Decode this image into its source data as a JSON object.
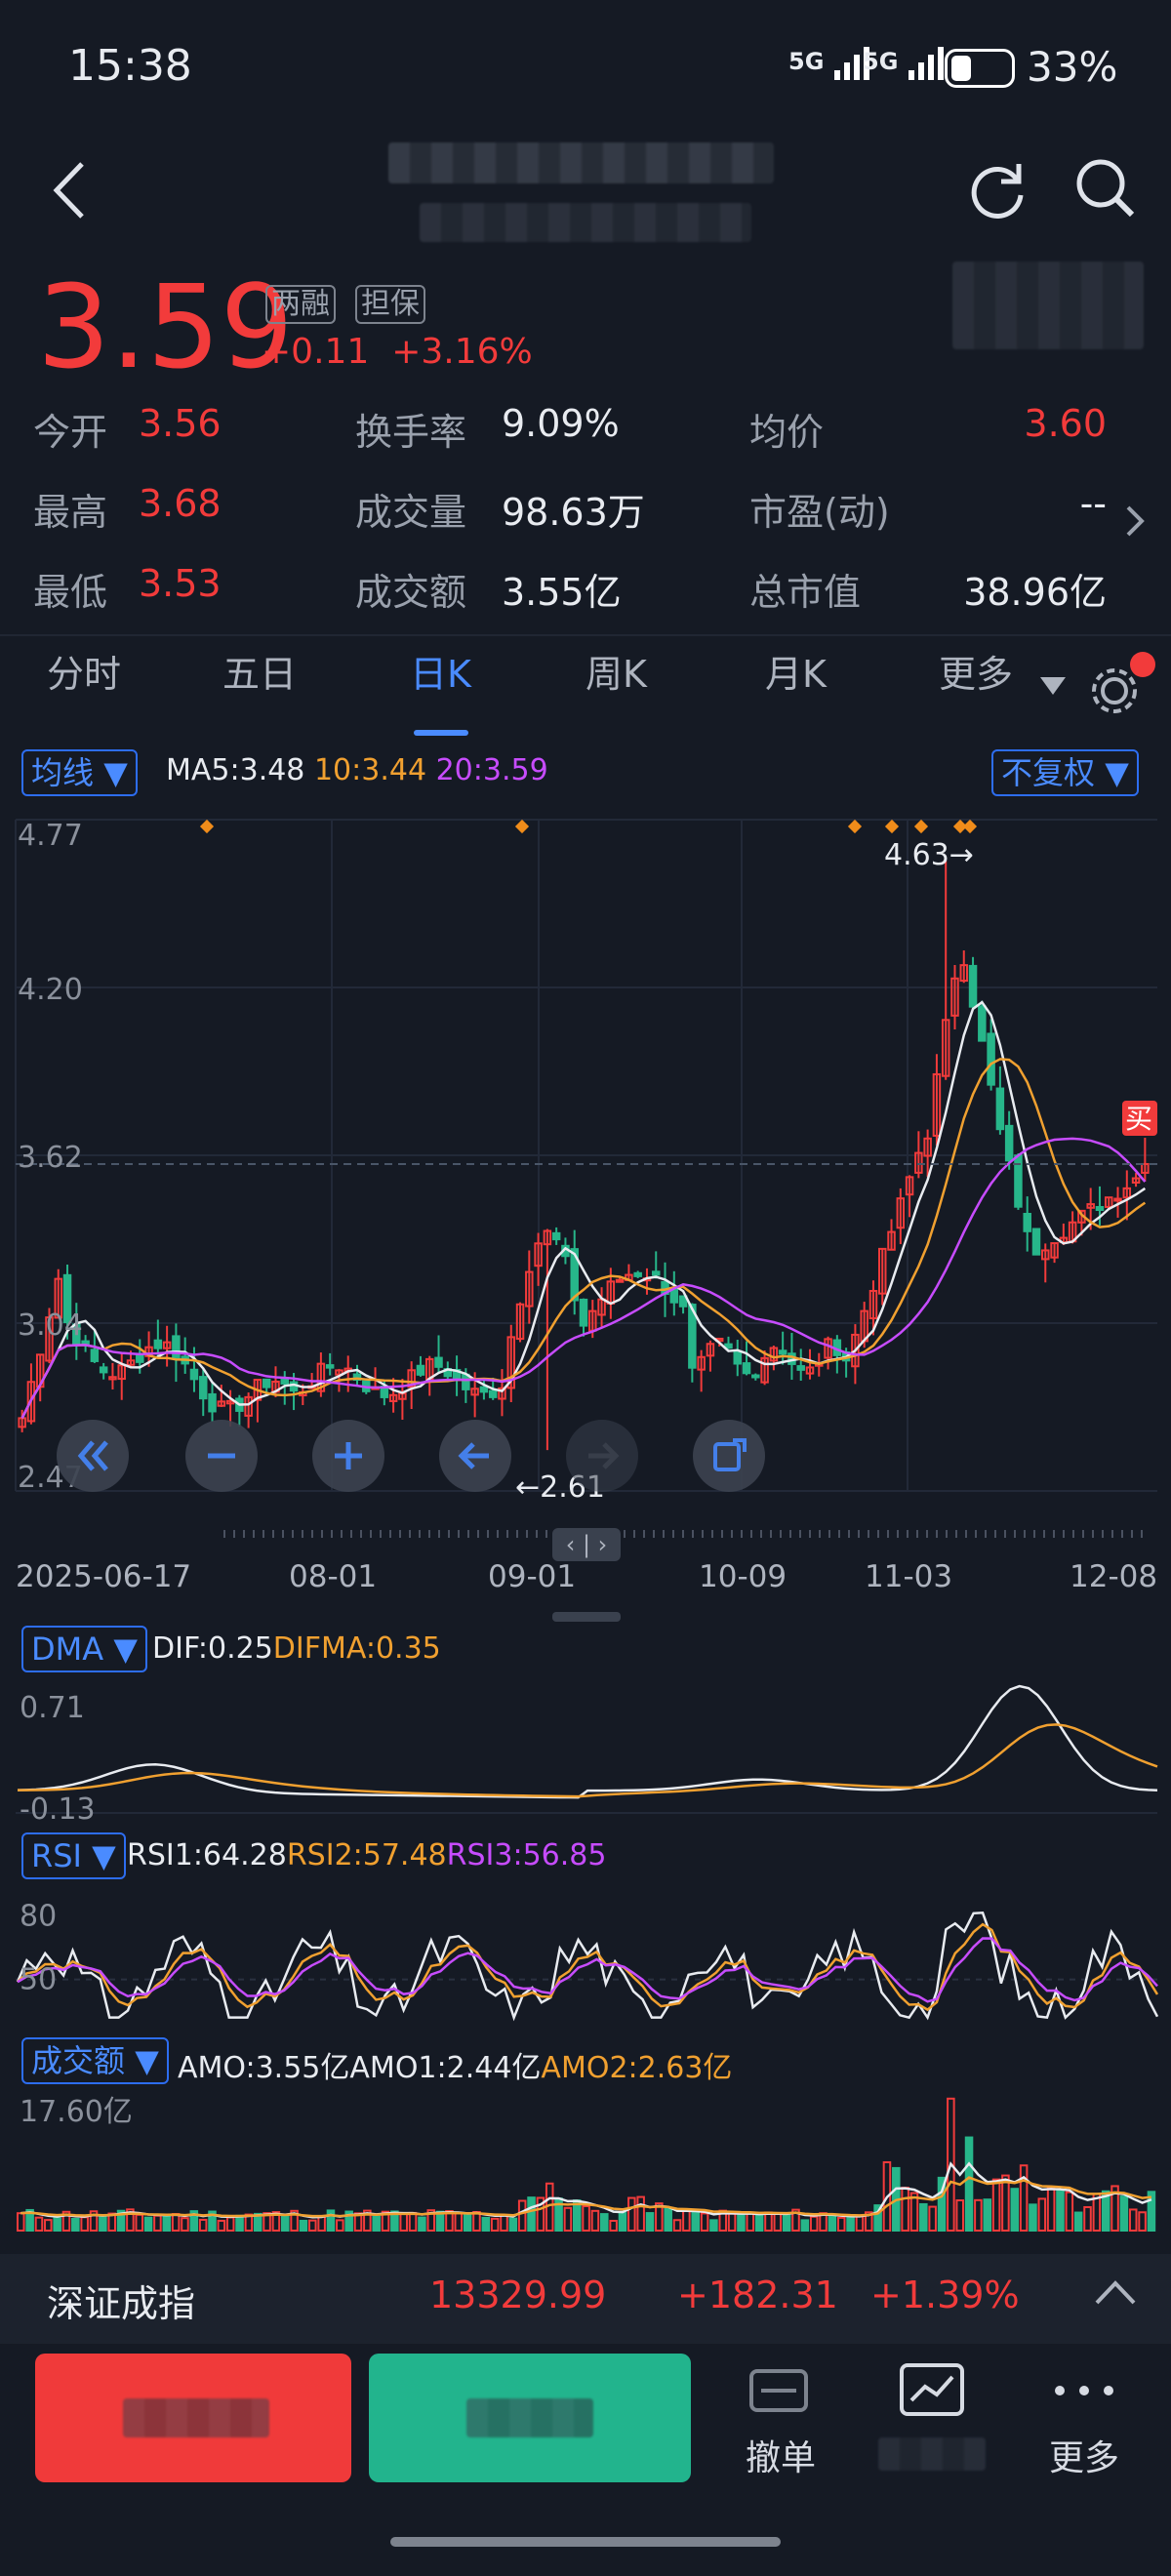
{
  "status_bar": {
    "time": "15:38",
    "net1": "5G",
    "net2": "5G",
    "battery": "33%",
    "battery_level": 0.33
  },
  "header": {
    "back_icon": "chevron-left-icon",
    "refresh_icon": "refresh-icon",
    "search_icon": "search-icon"
  },
  "quote": {
    "price": "3.59",
    "badge1": "两融",
    "badge2": "担保",
    "change": "+0.11",
    "change_pct": "+3.16%"
  },
  "stats": [
    {
      "label": "今开",
      "value": "3.56",
      "color": "#f23b3b"
    },
    {
      "label": "换手率",
      "value": "9.09%",
      "color": "#e8ebf0"
    },
    {
      "label": "均价",
      "value": "3.60",
      "color": "#f23b3b"
    },
    {
      "label": "最高",
      "value": "3.68",
      "color": "#f23b3b"
    },
    {
      "label": "成交量",
      "value": "98.63万",
      "color": "#e8ebf0"
    },
    {
      "label": "市盈(动)",
      "value": "--",
      "color": "#e8ebf0"
    },
    {
      "label": "最低",
      "value": "3.53",
      "color": "#f23b3b"
    },
    {
      "label": "成交额",
      "value": "3.55亿",
      "color": "#e8ebf0"
    },
    {
      "label": "总市值",
      "value": "38.96亿",
      "color": "#e8ebf0"
    }
  ],
  "tabs": [
    "分时",
    "五日",
    "日K",
    "周K",
    "月K",
    "更多"
  ],
  "active_tab": "日K",
  "kchart": {
    "ma_selector": "均线",
    "ma5": "MA5:3.48",
    "ma10": "10:3.44",
    "ma20": "20:3.59",
    "adjust_selector": "不复权",
    "y_ticks": [
      "4.77",
      "4.20",
      "3.62",
      "3.04",
      "2.47"
    ],
    "x_ticks": [
      "2025-06-17",
      "08-01",
      "09-01",
      "10-09",
      "11-03",
      "12-08"
    ],
    "high_annotation": "4.63→",
    "low_annotation": "←2.61",
    "buy_marker": "买",
    "scroll_handle": "‹ | ›"
  },
  "dma": {
    "selector": "DMA",
    "dif": "DIF:0.25",
    "difma": "DIFMA:0.35",
    "y_top": "0.71",
    "y_bottom": "-0.13"
  },
  "rsi": {
    "selector": "RSI",
    "rsi1": "RSI1:64.28",
    "rsi2": "RSI2:57.48",
    "rsi3": "RSI3:56.85",
    "y_top": "80",
    "y_mid": "50"
  },
  "amo": {
    "selector": "成交额",
    "amo": "AMO:3.55亿",
    "amo1": "AMO1:2.44亿",
    "amo2": "AMO2:2.63亿",
    "y_top": "17.60亿"
  },
  "index_bar": {
    "name": "深证成指",
    "value": "13329.99",
    "change": "+182.31",
    "pct": "+1.39%"
  },
  "actions": {
    "cancel": "撤单",
    "more": "更多"
  },
  "colors": {
    "up": "#f23b3b",
    "down": "#27b68a",
    "ma5": "#e8ebf0",
    "ma10": "#f0a030",
    "ma20": "#c74cff",
    "accent": "#4a8bff"
  }
}
